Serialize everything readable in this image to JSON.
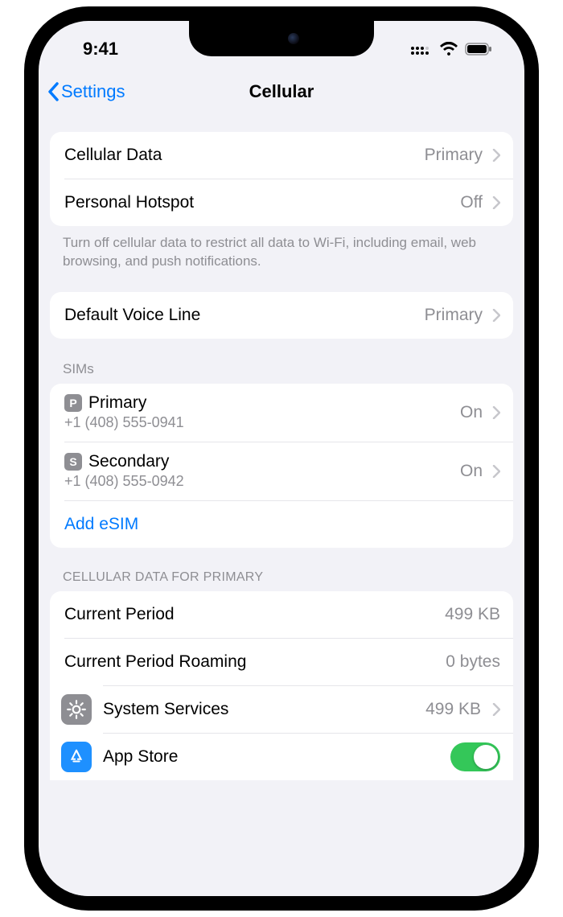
{
  "status": {
    "time": "9:41"
  },
  "nav": {
    "back": "Settings",
    "title": "Cellular"
  },
  "group1": {
    "cellular_data": {
      "label": "Cellular Data",
      "value": "Primary"
    },
    "hotspot": {
      "label": "Personal Hotspot",
      "value": "Off"
    },
    "footer": "Turn off cellular data to restrict all data to Wi-Fi, including email, web browsing, and push notifications."
  },
  "group2": {
    "voice_line": {
      "label": "Default Voice Line",
      "value": "Primary"
    }
  },
  "sims": {
    "header": "SIMs",
    "items": [
      {
        "badge": "P",
        "name": "Primary",
        "phone": "+1 (408) 555-0941",
        "status": "On"
      },
      {
        "badge": "S",
        "name": "Secondary",
        "phone": "+1 (408) 555-0942",
        "status": "On"
      }
    ],
    "add": "Add eSIM"
  },
  "data_usage": {
    "header": "CELLULAR DATA FOR PRIMARY",
    "current_period": {
      "label": "Current Period",
      "value": "499 KB"
    },
    "roaming": {
      "label": "Current Period Roaming",
      "value": "0 bytes"
    },
    "system_services": {
      "label": "System Services",
      "value": "499 KB"
    },
    "app_store": {
      "label": "App Store"
    }
  }
}
